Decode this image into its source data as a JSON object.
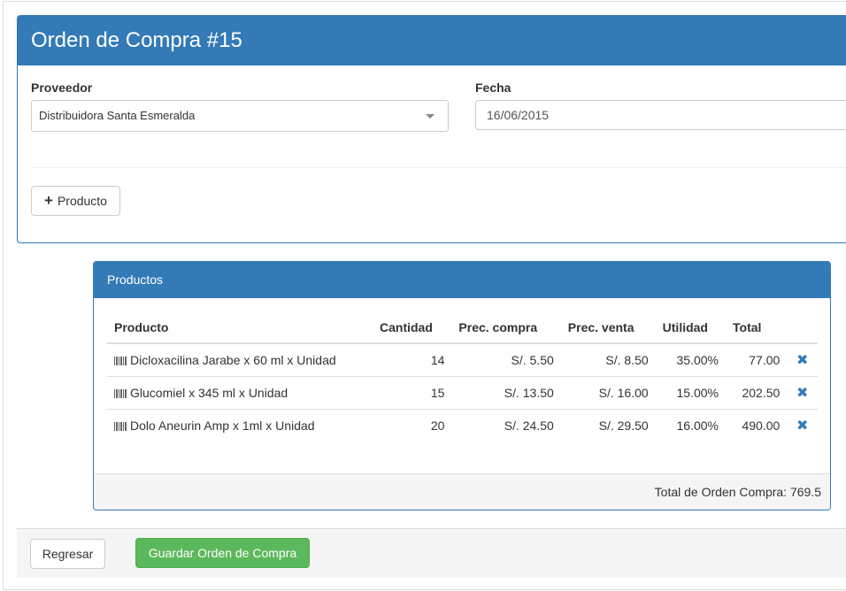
{
  "order": {
    "title": "Orden de Compra #15",
    "proveedor_label": "Proveedor",
    "proveedor_value": "Distribuidora Santa Esmeralda",
    "fecha_label": "Fecha",
    "fecha_value": "16/06/2015",
    "add_product_label": "Producto",
    "add_product_icon": "plus-icon"
  },
  "productos": {
    "title": "Productos",
    "columns": [
      "Producto",
      "Cantidad",
      "Prec. compra",
      "Prec. venta",
      "Utilidad",
      "Total"
    ],
    "rows": [
      {
        "producto": "Dicloxacilina Jarabe x 60 ml x Unidad",
        "cantidad": "14",
        "prec_compra": "S/. 5.50",
        "prec_venta": "S/. 8.50",
        "utilidad": "35.00%",
        "total": "77.00"
      },
      {
        "producto": "Glucomiel x 345 ml x Unidad",
        "cantidad": "15",
        "prec_compra": "S/. 13.50",
        "prec_venta": "S/. 16.00",
        "utilidad": "15.00%",
        "total": "202.50"
      },
      {
        "producto": "Dolo Aneurin Amp x 1ml x Unidad",
        "cantidad": "20",
        "prec_compra": "S/. 24.50",
        "prec_venta": "S/. 29.50",
        "utilidad": "16.00%",
        "total": "490.00"
      }
    ],
    "delete_glyph": "✖",
    "total_text": "Total de Orden Compra: 769.5"
  },
  "actions": {
    "back_label": "Regresar",
    "save_label": "Guardar Orden de Compra"
  },
  "colors": {
    "primary": "#337ab7",
    "success": "#5cb85c"
  }
}
